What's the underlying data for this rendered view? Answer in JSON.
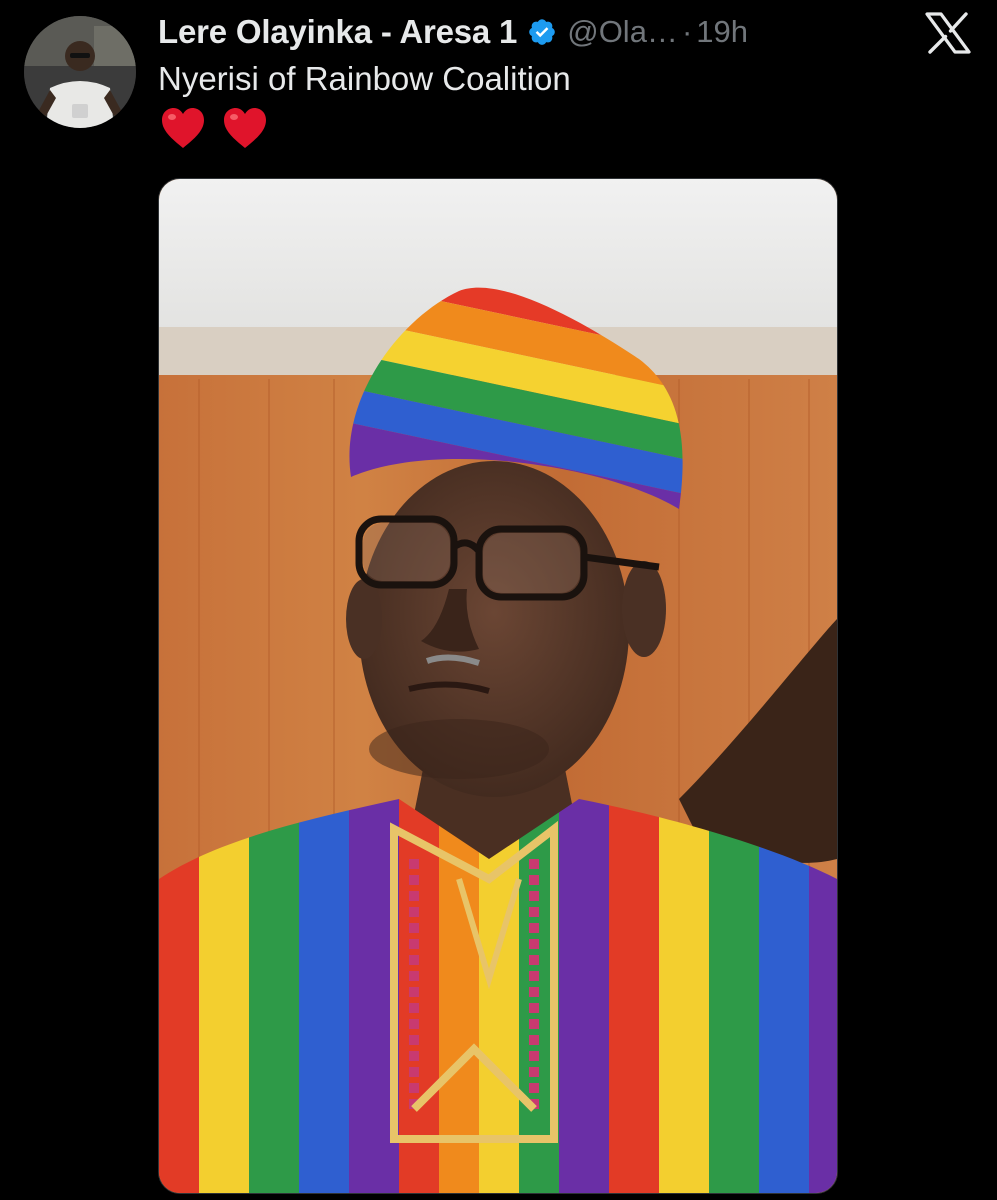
{
  "tweet": {
    "display_name": "Lere Olayinka - Aresa 1",
    "handle": "@Ola…",
    "separator": "·",
    "time": "19h",
    "text": "Nyerisi of Rainbow Coalition",
    "emojis": [
      "red-heart",
      "red-heart"
    ]
  },
  "icons": {
    "verified": "verified-badge-icon",
    "close": "x-logo-icon"
  },
  "colors": {
    "background": "#000000",
    "primary_text": "#e7e9ea",
    "secondary_text": "#71767b",
    "verified_blue": "#1d9bf0",
    "heart_red": "#e0142b"
  }
}
